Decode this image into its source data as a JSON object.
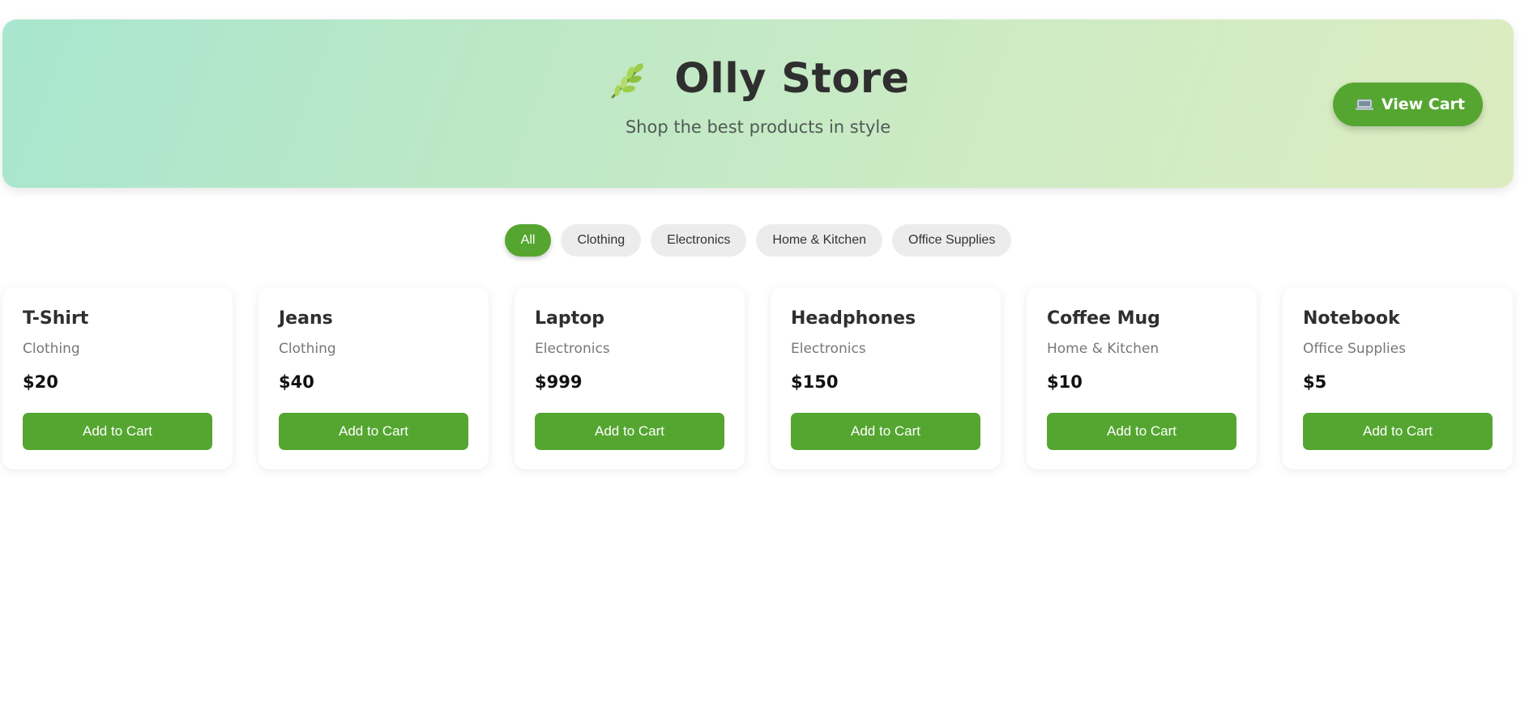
{
  "header": {
    "logo_icon": "leaf-icon",
    "title": "Olly Store",
    "subtitle": "Shop the best products in style",
    "view_cart_icon": "cart-icon",
    "view_cart_label": "View Cart"
  },
  "colors": {
    "accent": "#55a630",
    "header_gradient_start": "#a8e6cf",
    "header_gradient_end": "#dcecc0"
  },
  "filters": [
    {
      "label": "All",
      "active": true
    },
    {
      "label": "Clothing",
      "active": false
    },
    {
      "label": "Electronics",
      "active": false
    },
    {
      "label": "Home & Kitchen",
      "active": false
    },
    {
      "label": "Office Supplies",
      "active": false
    }
  ],
  "products": [
    {
      "name": "T-Shirt",
      "category": "Clothing",
      "price": "$20",
      "button": "Add to Cart"
    },
    {
      "name": "Jeans",
      "category": "Clothing",
      "price": "$40",
      "button": "Add to Cart"
    },
    {
      "name": "Laptop",
      "category": "Electronics",
      "price": "$999",
      "button": "Add to Cart"
    },
    {
      "name": "Headphones",
      "category": "Electronics",
      "price": "$150",
      "button": "Add to Cart"
    },
    {
      "name": "Coffee Mug",
      "category": "Home & Kitchen",
      "price": "$10",
      "button": "Add to Cart"
    },
    {
      "name": "Notebook",
      "category": "Office Supplies",
      "price": "$5",
      "button": "Add to Cart"
    }
  ]
}
